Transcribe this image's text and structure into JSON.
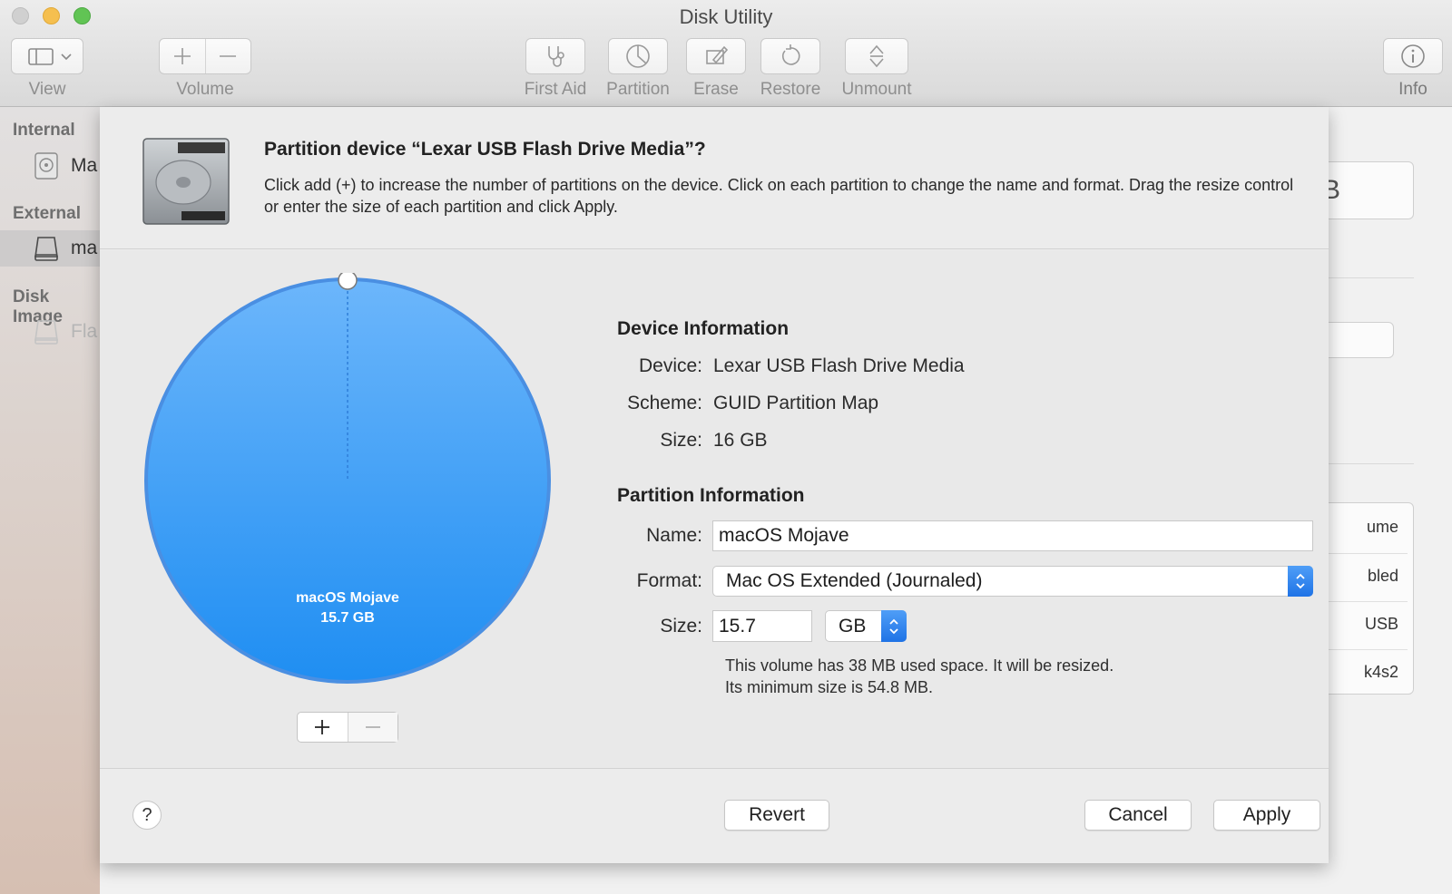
{
  "window": {
    "title": "Disk Utility"
  },
  "toolbar": {
    "view_label": "View",
    "volume_label": "Volume",
    "first_aid_label": "First Aid",
    "partition_label": "Partition",
    "erase_label": "Erase",
    "restore_label": "Restore",
    "unmount_label": "Unmount",
    "info_label": "Info"
  },
  "sidebar": {
    "internal_heading": "Internal",
    "internal_item": "Ma",
    "external_heading": "External",
    "external_item": "ma",
    "disk_images_heading": "Disk Image",
    "disk_images_item": "Fla"
  },
  "background": {
    "big_box_text": "B",
    "list_rows": [
      "ume",
      "bled",
      "USB",
      "k4s2"
    ]
  },
  "dialog": {
    "title": "Partition device “Lexar USB Flash Drive Media”?",
    "description": "Click add (+) to increase the number of partitions on the device. Click on each partition to change the name and format. Drag the resize control or enter the size of each partition and click Apply.",
    "pie": {
      "partition_name": "macOS Mojave",
      "partition_size": "15.7 GB",
      "color": "#3a9bf5"
    },
    "device_info": {
      "heading": "Device Information",
      "device_label": "Device:",
      "device_value": "Lexar USB Flash Drive Media",
      "scheme_label": "Scheme:",
      "scheme_value": "GUID Partition Map",
      "size_label": "Size:",
      "size_value": "16 GB"
    },
    "partition_info": {
      "heading": "Partition Information",
      "name_label": "Name:",
      "name_value": "macOS Mojave",
      "format_label": "Format:",
      "format_value": "Mac OS Extended (Journaled)",
      "size_label": "Size:",
      "size_value": "15.7",
      "unit_value": "GB",
      "note_line1": "This volume has 38 MB used space. It will be resized.",
      "note_line2": "Its minimum size is 54.8 MB."
    },
    "buttons": {
      "help": "?",
      "revert": "Revert",
      "cancel": "Cancel",
      "apply": "Apply"
    }
  }
}
